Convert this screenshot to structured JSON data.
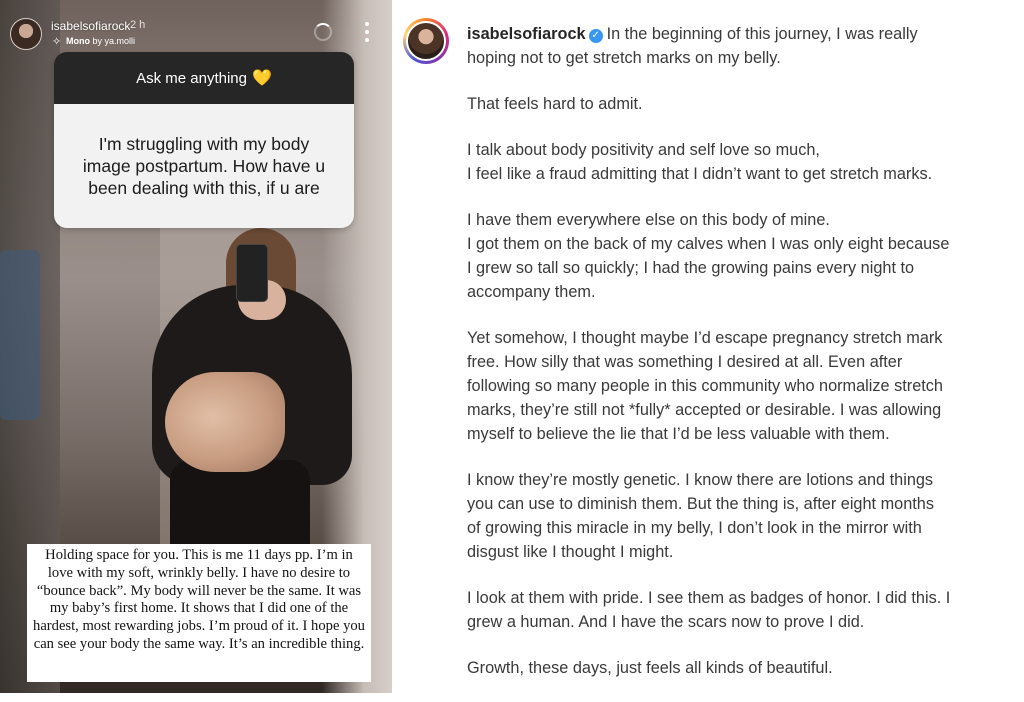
{
  "story": {
    "username": "isabelsofiarock",
    "time": "2 h",
    "music_prefix": "Mono",
    "music_credit": "by ya.molli",
    "question_header": "Ask me anything",
    "question_emoji": "💛",
    "question_text": "I'm struggling with my body image postpartum. How have u been dealing with this, if u are",
    "caption": "Holding space for you. This is me 11 days pp. I’m in love with my soft, wrinkly belly. I have no desire to “bounce back”. My body will never be the same. It was my baby’s first home. It shows that I did one of the hardest, most rewarding jobs. I’m proud of it. I hope you can see your body the same way. It’s an incredible thing."
  },
  "post": {
    "username": "isabelsofiarock",
    "verified_glyph": "✓",
    "paragraphs": [
      [
        "In the beginning of this journey, I was really",
        "hoping not to get stretch marks on my belly."
      ],
      [
        "That feels hard to admit."
      ],
      [
        "I talk about body positivity and self love so much,",
        "I feel like a fraud admitting that I didn’t want to get stretch marks."
      ],
      [
        "I have them everywhere else on this body of mine.",
        "I got them on the back of my calves when I was only eight because",
        "I grew so tall so quickly; I had the growing pains every night to",
        "accompany them."
      ],
      [
        "Yet somehow, I thought maybe I’d escape pregnancy stretch mark",
        "free. How silly that was something I desired at all. Even after",
        "following so many people in this community who normalize stretch",
        "marks, they’re still not *fully* accepted or desirable. I was allowing",
        "myself to believe the lie that I’d be less valuable with them."
      ],
      [
        "I know they’re mostly genetic. I know there are lotions and things",
        "you can use to diminish them. But the thing is, after eight months",
        "of growing this miracle in my belly, I don’t look in the mirror with",
        "disgust like I thought I might."
      ],
      [
        "I look at them with pride. I see them as badges of honor. I did this. I",
        "grew a human. And I have the scars now to prove I did."
      ],
      [
        "Growth, these days, just feels all kinds of beautiful."
      ]
    ]
  }
}
